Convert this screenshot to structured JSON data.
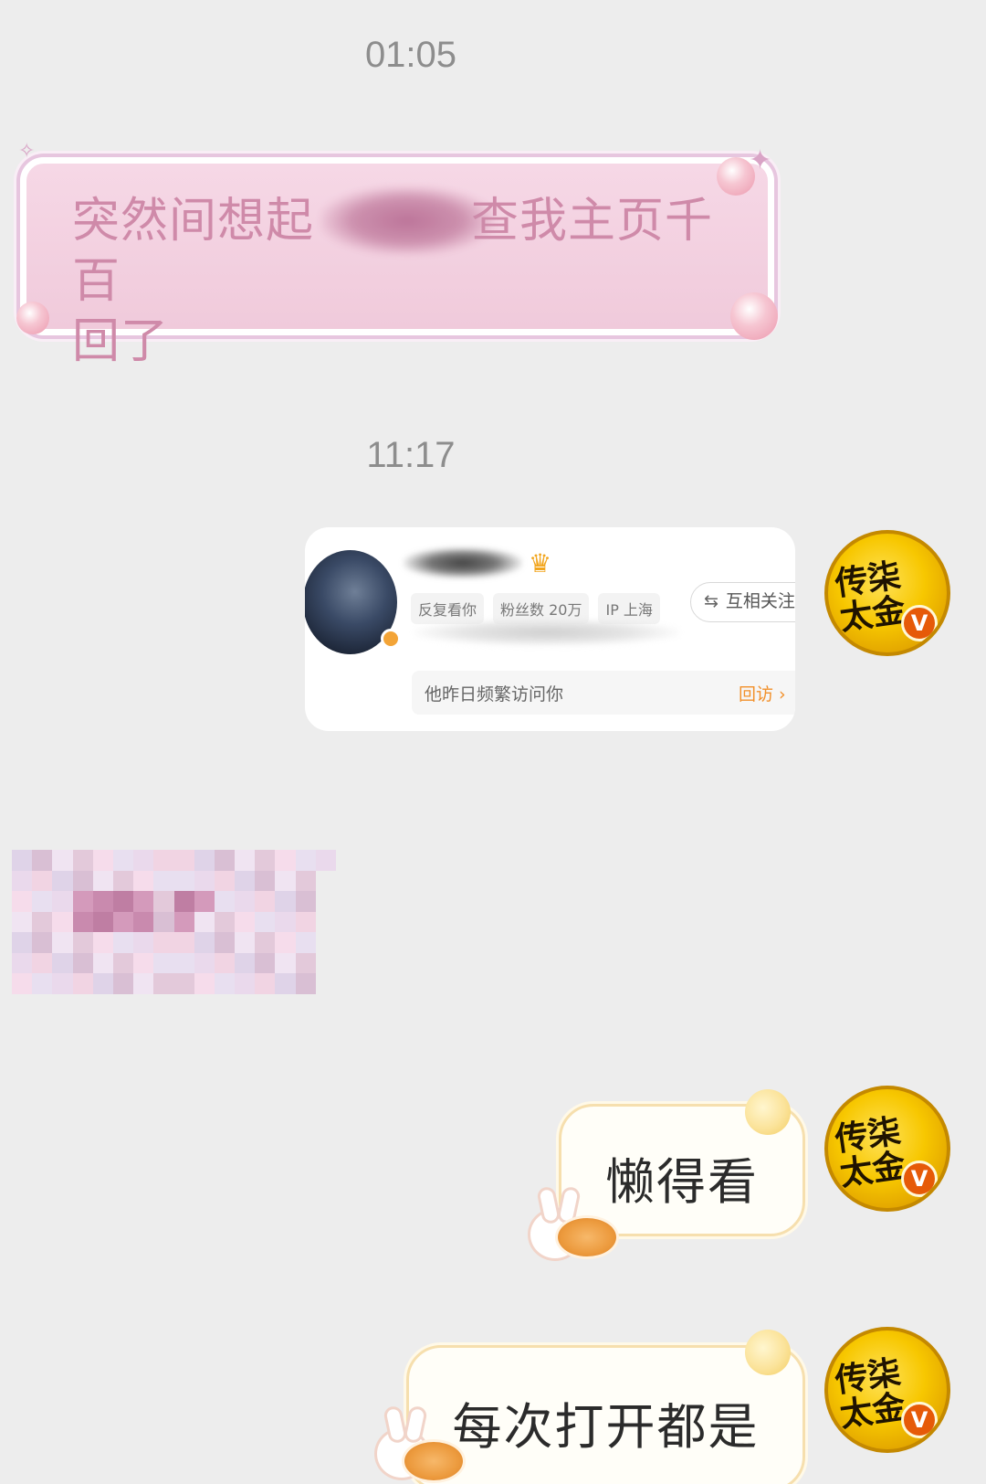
{
  "timestamps": [
    "01:05",
    "11:17"
  ],
  "messages": {
    "first": {
      "text_line1": "突然间想起",
      "text_line1_after": "查我主页千百",
      "text_line2": "回了"
    },
    "reply1": "懒得看",
    "reply2": "每次打开都是"
  },
  "profile_card": {
    "tags": [
      "反复看你",
      "粉丝数 20万",
      "IP 上海"
    ],
    "follow_button": "互相关注",
    "follow_icon": "⇆",
    "visit_text": "他昨日频繁访问你",
    "revisit_label": "回访 ›"
  },
  "avatar": {
    "verified_badge": "V",
    "icon": "calligraphy-avatar"
  },
  "colors": {
    "background": "#ededed",
    "pink_bubble": "#f0cadb",
    "pink_text": "#cf8aa9",
    "accent_orange": "#f2902a"
  }
}
